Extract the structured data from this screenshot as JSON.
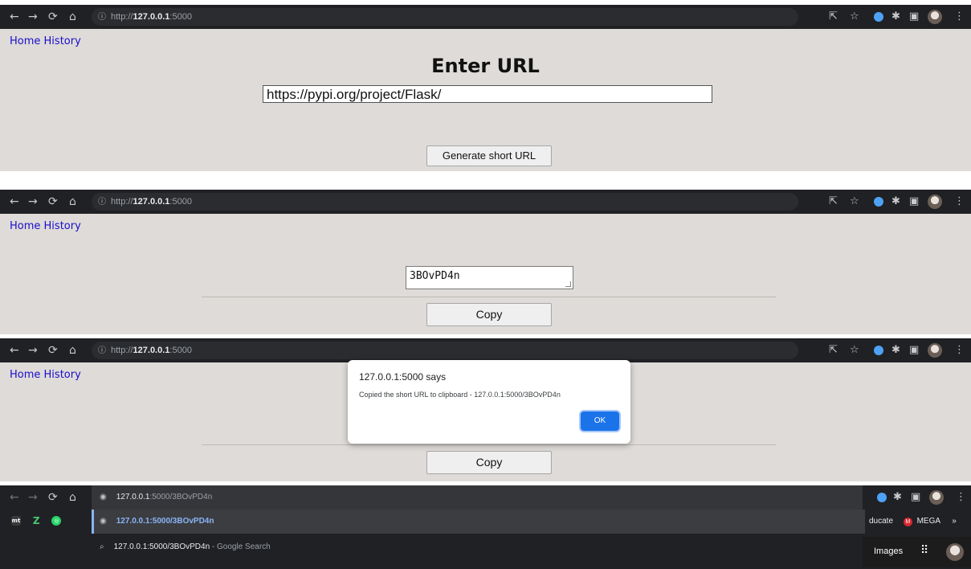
{
  "browser": {
    "address": {
      "prefix": "http://",
      "host": "127.0.0.1",
      "port": ":5000"
    }
  },
  "nav": {
    "home": "Home",
    "history": "History"
  },
  "step1": {
    "heading": "Enter URL",
    "url_value": "https://pypi.org/project/Flask/",
    "generate_label": "Generate short URL"
  },
  "step2": {
    "short_code": "3BOvPD4n",
    "copy_label": "Copy"
  },
  "step3": {
    "dialog_title": "127.0.0.1:5000 says",
    "dialog_message": "Copied the short URL to clipboard - 127.0.0.1:5000/3BOvPD4n",
    "ok_label": "OK",
    "copy_label": "Copy"
  },
  "step4": {
    "omnibox_host": "127.0.0.1",
    "omnibox_rest": ":5000/3BOvPD4n",
    "suggestion_url": "127.0.0.1:5000/3BOvPD4n",
    "search_query": "127.0.0.1:5000/3BOvPD4n",
    "search_suffix": " - Google Search",
    "bookmark_educate": "ducate",
    "bookmark_mega": "MEGA",
    "images_label": "Images",
    "more": "»"
  }
}
